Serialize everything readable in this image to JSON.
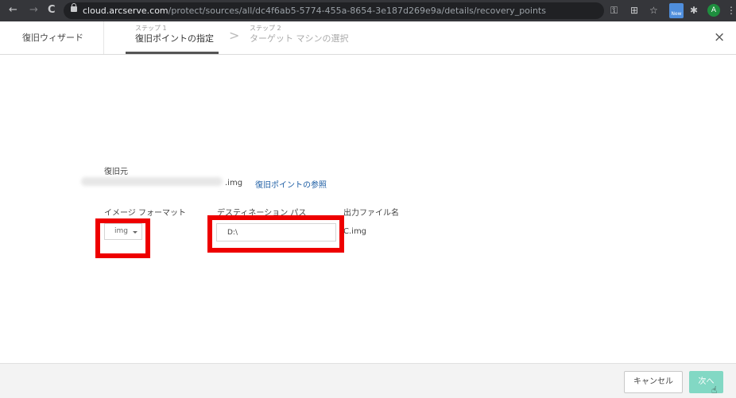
{
  "browser": {
    "back": "←",
    "forward": "→",
    "reload": "C",
    "url_host": "cloud.arcserve.com",
    "url_path": "/protect/sources/all/dc4f6ab5-5774-455a-8654-3e187d269e9a/details/recovery_points",
    "ext_new_label": "New",
    "avatar_letter": "A",
    "icons": [
      "lock-icon",
      "key-icon",
      "translate-icon",
      "star-icon",
      "extension-new-icon",
      "puzzle-icon",
      "menu-icon"
    ]
  },
  "wizard": {
    "title": "復旧ウィザード",
    "steps": [
      {
        "label": "ステップ 1",
        "name": "復旧ポイントの指定"
      },
      {
        "label": "ステップ 2",
        "name": "ターゲット マシンの選択"
      }
    ],
    "separator": ">",
    "close": "×"
  },
  "form": {
    "source_label": "復旧元",
    "source_ext": ".img",
    "browse_link": "復旧ポイントの参照",
    "image_format_label": "イメージ フォーマット",
    "image_format_value": "img",
    "destination_label": "デスティネーション パス",
    "destination_value": "D:\\",
    "output_label": "出力ファイル名",
    "output_value": "C.img"
  },
  "footer": {
    "cancel_label": "キャンセル",
    "next_label": "次へ"
  },
  "colors": {
    "highlight": "#ee0000",
    "link": "#1f5fa5",
    "next_button": "#82d8c4"
  }
}
